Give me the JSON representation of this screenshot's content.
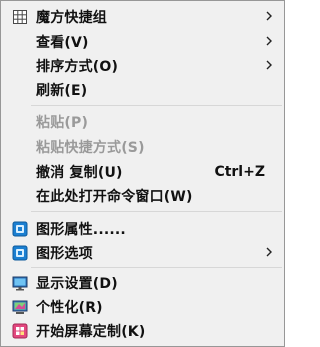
{
  "menu": {
    "group_view": {
      "magic_cube": {
        "label": "魔方快捷组",
        "icon": "grid-icon"
      },
      "view": {
        "label": "查看(V)"
      },
      "sort": {
        "label": "排序方式(O)"
      },
      "refresh": {
        "label": "刷新(E)"
      }
    },
    "group_edit": {
      "paste": {
        "label": "粘贴(P)"
      },
      "paste_shortcut": {
        "label": "粘贴快捷方式(S)"
      },
      "undo_copy": {
        "label": "撤消 复制(U)",
        "shortcut": "Ctrl+Z"
      },
      "open_cmd": {
        "label": "在此处打开命令窗口(W)"
      }
    },
    "group_graphics": {
      "graphics_properties": {
        "label": "图形属性......",
        "icon": "graphics-icon"
      },
      "graphics_options": {
        "label": "图形选项",
        "icon": "graphics-icon"
      }
    },
    "group_personal": {
      "display_settings": {
        "label": "显示设置(D)",
        "icon": "monitor-icon"
      },
      "personalize": {
        "label": "个性化(R)",
        "icon": "personalize-icon"
      },
      "start_screen": {
        "label": "开始屏幕定制(K)",
        "icon": "start-screen-icon"
      }
    },
    "colors": {
      "background": "#f0f0f0",
      "border": "#979797",
      "text": "#111111",
      "disabled_text": "#9a9a9a"
    }
  }
}
